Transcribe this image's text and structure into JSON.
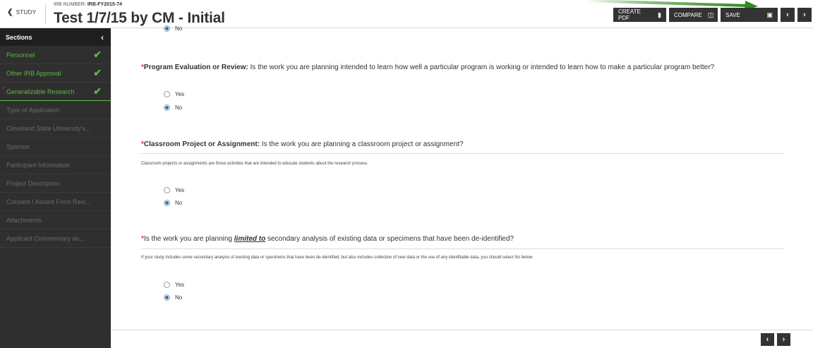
{
  "header": {
    "back_label": "STUDY",
    "irb_prefix": "IRB NUMBER:",
    "irb_number": "IRB-FY2015-74",
    "title": "Test 1/7/15 by CM - Initial",
    "actions": {
      "create_pdf": "CREATE PDF",
      "compare": "COMPARE",
      "save": "SAVE"
    }
  },
  "sidebar": {
    "heading": "Sections",
    "items": [
      {
        "label": "Personnel",
        "status": "complete"
      },
      {
        "label": "Other IRB Approval",
        "status": "complete"
      },
      {
        "label": "Generalizable Research",
        "status": "complete-current"
      },
      {
        "label": "Type of Application",
        "status": "inactive"
      },
      {
        "label": "Cleveland State University's...",
        "status": "inactive"
      },
      {
        "label": "Sponsor",
        "status": "inactive"
      },
      {
        "label": "Participant Information",
        "status": "inactive"
      },
      {
        "label": "Project Description",
        "status": "inactive"
      },
      {
        "label": "Consent / Assent Form Revi...",
        "status": "inactive"
      },
      {
        "label": "Attachments",
        "status": "inactive"
      },
      {
        "label": "Applicant Commentary an...",
        "status": "inactive"
      }
    ]
  },
  "form": {
    "top_partial_option": "No",
    "questions": [
      {
        "label": "Program Evaluation or Review:",
        "text": " Is the work you are planning intended to learn how well a particular program is working or intended to learn how to make a particular program better?",
        "options": [
          "Yes",
          "No"
        ],
        "selected": "No"
      },
      {
        "label": "Classroom Project or Assignment:",
        "text": " Is the work you are planning a classroom project or assignment?",
        "help": "Classroom projects or assignments are those activities that are intended to educate students about the research process.",
        "options": [
          "Yes",
          "No"
        ],
        "selected": "No"
      },
      {
        "pre": "Is the work you are planning ",
        "emph": "limited to",
        "post": " secondary analysis of existing data or specimens that have been de-identified?",
        "help": "If your study includes some secondary analysis of existing data or specimens that have been de-identified, but also includes collection of new data or the use of any identifiable data, you should select No below.",
        "options": [
          "Yes",
          "No"
        ],
        "selected": "No"
      }
    ]
  },
  "colors": {
    "sidebar_bg": "#2f2f2f",
    "complete_green": "#5fb547",
    "required_red": "#d83a2e",
    "annotation_arrow": "#2e8b1e"
  },
  "icons": {
    "back": "chevron-left-icon",
    "pdf": "file-icon",
    "compare": "columns-icon",
    "save": "floppy-disk-icon",
    "check": "checkmark-icon"
  }
}
